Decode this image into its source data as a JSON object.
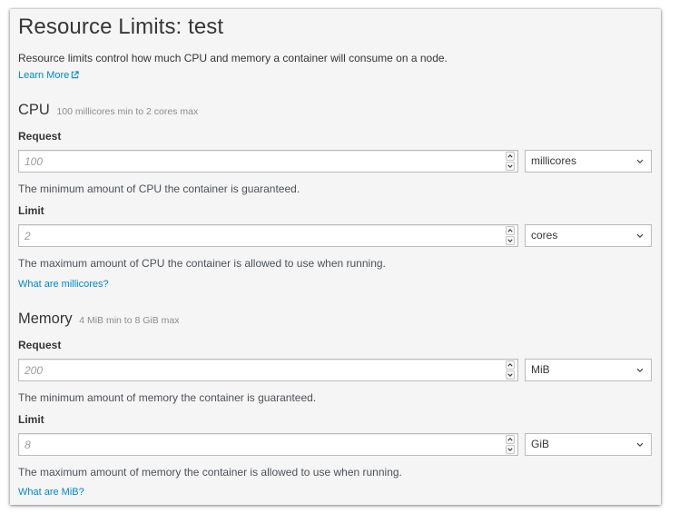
{
  "page": {
    "title": "Resource Limits: test",
    "intro": "Resource limits control how much CPU and memory a container will consume on a node.",
    "learn_more": "Learn More"
  },
  "cpu": {
    "heading": "CPU",
    "range": "100 millicores min to 2 cores max",
    "request": {
      "label": "Request",
      "placeholder": "100",
      "value": "",
      "unit": "millicores",
      "help": "The minimum amount of CPU the container is guaranteed."
    },
    "limit": {
      "label": "Limit",
      "placeholder": "2",
      "value": "",
      "unit": "cores",
      "help": "The maximum amount of CPU the container is allowed to use when running."
    },
    "help_link": "What are millicores?"
  },
  "memory": {
    "heading": "Memory",
    "range": "4 MiB min to 8 GiB max",
    "request": {
      "label": "Request",
      "placeholder": "200",
      "value": "",
      "unit": "MiB",
      "help": "The minimum amount of memory the container is guaranteed."
    },
    "limit": {
      "label": "Limit",
      "placeholder": "8",
      "value": "",
      "unit": "GiB",
      "help": "The maximum amount of memory the container is allowed to use when running."
    },
    "help_link": "What are MiB?"
  },
  "icons": {
    "external_link": "external-link-icon",
    "spinner_up": "caret-up-icon",
    "spinner_down": "caret-down-icon",
    "select_caret": "chevron-down-icon"
  },
  "colors": {
    "link": "#0088ce",
    "text": "#363636",
    "muted": "#8b8d8f",
    "card_bg": "#f5f5f5",
    "border": "#bbbbbb"
  }
}
